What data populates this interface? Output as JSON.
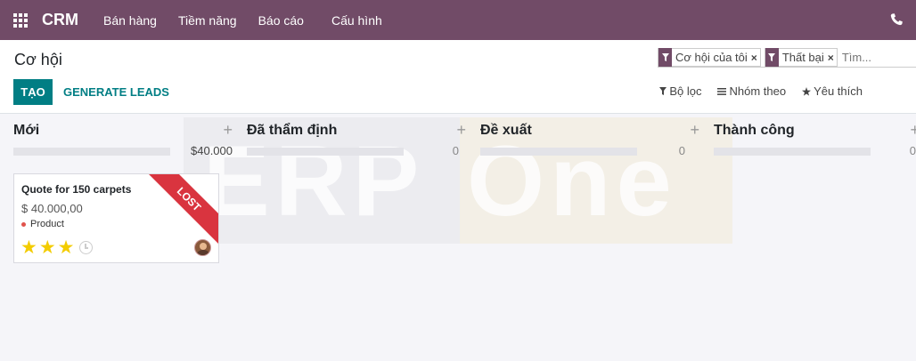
{
  "navbar": {
    "brand": "CRM",
    "menu": [
      "Bán hàng",
      "Tiềm năng",
      "Báo cáo",
      "Cấu hình"
    ]
  },
  "control": {
    "title": "Cơ hội",
    "create_label": "TẠO",
    "generate_label": "GENERATE LEADS",
    "search": {
      "facets": [
        "Cơ hội của tôi",
        "Thất bại"
      ],
      "placeholder": "Tìm..."
    },
    "filters": {
      "filter_label": "Bộ lọc",
      "group_label": "Nhóm theo",
      "favorite_label": "Yêu thích"
    }
  },
  "watermark": {
    "left": "ERP",
    "right": "One"
  },
  "columns": [
    {
      "title": "Mới",
      "total": "$40.000"
    },
    {
      "title": "Đã thẩm định",
      "total": "0"
    },
    {
      "title": "Đề xuất",
      "total": "0"
    },
    {
      "title": "Thành công",
      "total": "0"
    }
  ],
  "card": {
    "title": "Quote for 150 carpets",
    "amount": "$ 40.000,00",
    "tag": "Product",
    "ribbon": "LOST",
    "stars": 3
  },
  "colors": {
    "brand": "#714b67",
    "accent": "#017e84",
    "ribbon": "#d9343f",
    "star": "#f3cc00"
  }
}
